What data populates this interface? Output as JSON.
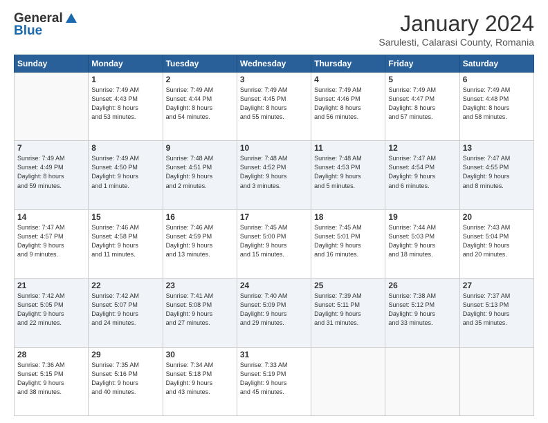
{
  "logo": {
    "line1": "General",
    "line2": "Blue"
  },
  "header": {
    "title": "January 2024",
    "subtitle": "Sarulesti, Calarasi County, Romania"
  },
  "weekdays": [
    "Sunday",
    "Monday",
    "Tuesday",
    "Wednesday",
    "Thursday",
    "Friday",
    "Saturday"
  ],
  "weeks": [
    [
      {
        "num": "",
        "info": ""
      },
      {
        "num": "1",
        "info": "Sunrise: 7:49 AM\nSunset: 4:43 PM\nDaylight: 8 hours\nand 53 minutes."
      },
      {
        "num": "2",
        "info": "Sunrise: 7:49 AM\nSunset: 4:44 PM\nDaylight: 8 hours\nand 54 minutes."
      },
      {
        "num": "3",
        "info": "Sunrise: 7:49 AM\nSunset: 4:45 PM\nDaylight: 8 hours\nand 55 minutes."
      },
      {
        "num": "4",
        "info": "Sunrise: 7:49 AM\nSunset: 4:46 PM\nDaylight: 8 hours\nand 56 minutes."
      },
      {
        "num": "5",
        "info": "Sunrise: 7:49 AM\nSunset: 4:47 PM\nDaylight: 8 hours\nand 57 minutes."
      },
      {
        "num": "6",
        "info": "Sunrise: 7:49 AM\nSunset: 4:48 PM\nDaylight: 8 hours\nand 58 minutes."
      }
    ],
    [
      {
        "num": "7",
        "info": "Sunrise: 7:49 AM\nSunset: 4:49 PM\nDaylight: 8 hours\nand 59 minutes."
      },
      {
        "num": "8",
        "info": "Sunrise: 7:49 AM\nSunset: 4:50 PM\nDaylight: 9 hours\nand 1 minute."
      },
      {
        "num": "9",
        "info": "Sunrise: 7:48 AM\nSunset: 4:51 PM\nDaylight: 9 hours\nand 2 minutes."
      },
      {
        "num": "10",
        "info": "Sunrise: 7:48 AM\nSunset: 4:52 PM\nDaylight: 9 hours\nand 3 minutes."
      },
      {
        "num": "11",
        "info": "Sunrise: 7:48 AM\nSunset: 4:53 PM\nDaylight: 9 hours\nand 5 minutes."
      },
      {
        "num": "12",
        "info": "Sunrise: 7:47 AM\nSunset: 4:54 PM\nDaylight: 9 hours\nand 6 minutes."
      },
      {
        "num": "13",
        "info": "Sunrise: 7:47 AM\nSunset: 4:55 PM\nDaylight: 9 hours\nand 8 minutes."
      }
    ],
    [
      {
        "num": "14",
        "info": "Sunrise: 7:47 AM\nSunset: 4:57 PM\nDaylight: 9 hours\nand 9 minutes."
      },
      {
        "num": "15",
        "info": "Sunrise: 7:46 AM\nSunset: 4:58 PM\nDaylight: 9 hours\nand 11 minutes."
      },
      {
        "num": "16",
        "info": "Sunrise: 7:46 AM\nSunset: 4:59 PM\nDaylight: 9 hours\nand 13 minutes."
      },
      {
        "num": "17",
        "info": "Sunrise: 7:45 AM\nSunset: 5:00 PM\nDaylight: 9 hours\nand 15 minutes."
      },
      {
        "num": "18",
        "info": "Sunrise: 7:45 AM\nSunset: 5:01 PM\nDaylight: 9 hours\nand 16 minutes."
      },
      {
        "num": "19",
        "info": "Sunrise: 7:44 AM\nSunset: 5:03 PM\nDaylight: 9 hours\nand 18 minutes."
      },
      {
        "num": "20",
        "info": "Sunrise: 7:43 AM\nSunset: 5:04 PM\nDaylight: 9 hours\nand 20 minutes."
      }
    ],
    [
      {
        "num": "21",
        "info": "Sunrise: 7:42 AM\nSunset: 5:05 PM\nDaylight: 9 hours\nand 22 minutes."
      },
      {
        "num": "22",
        "info": "Sunrise: 7:42 AM\nSunset: 5:07 PM\nDaylight: 9 hours\nand 24 minutes."
      },
      {
        "num": "23",
        "info": "Sunrise: 7:41 AM\nSunset: 5:08 PM\nDaylight: 9 hours\nand 27 minutes."
      },
      {
        "num": "24",
        "info": "Sunrise: 7:40 AM\nSunset: 5:09 PM\nDaylight: 9 hours\nand 29 minutes."
      },
      {
        "num": "25",
        "info": "Sunrise: 7:39 AM\nSunset: 5:11 PM\nDaylight: 9 hours\nand 31 minutes."
      },
      {
        "num": "26",
        "info": "Sunrise: 7:38 AM\nSunset: 5:12 PM\nDaylight: 9 hours\nand 33 minutes."
      },
      {
        "num": "27",
        "info": "Sunrise: 7:37 AM\nSunset: 5:13 PM\nDaylight: 9 hours\nand 35 minutes."
      }
    ],
    [
      {
        "num": "28",
        "info": "Sunrise: 7:36 AM\nSunset: 5:15 PM\nDaylight: 9 hours\nand 38 minutes."
      },
      {
        "num": "29",
        "info": "Sunrise: 7:35 AM\nSunset: 5:16 PM\nDaylight: 9 hours\nand 40 minutes."
      },
      {
        "num": "30",
        "info": "Sunrise: 7:34 AM\nSunset: 5:18 PM\nDaylight: 9 hours\nand 43 minutes."
      },
      {
        "num": "31",
        "info": "Sunrise: 7:33 AM\nSunset: 5:19 PM\nDaylight: 9 hours\nand 45 minutes."
      },
      {
        "num": "",
        "info": ""
      },
      {
        "num": "",
        "info": ""
      },
      {
        "num": "",
        "info": ""
      }
    ]
  ]
}
